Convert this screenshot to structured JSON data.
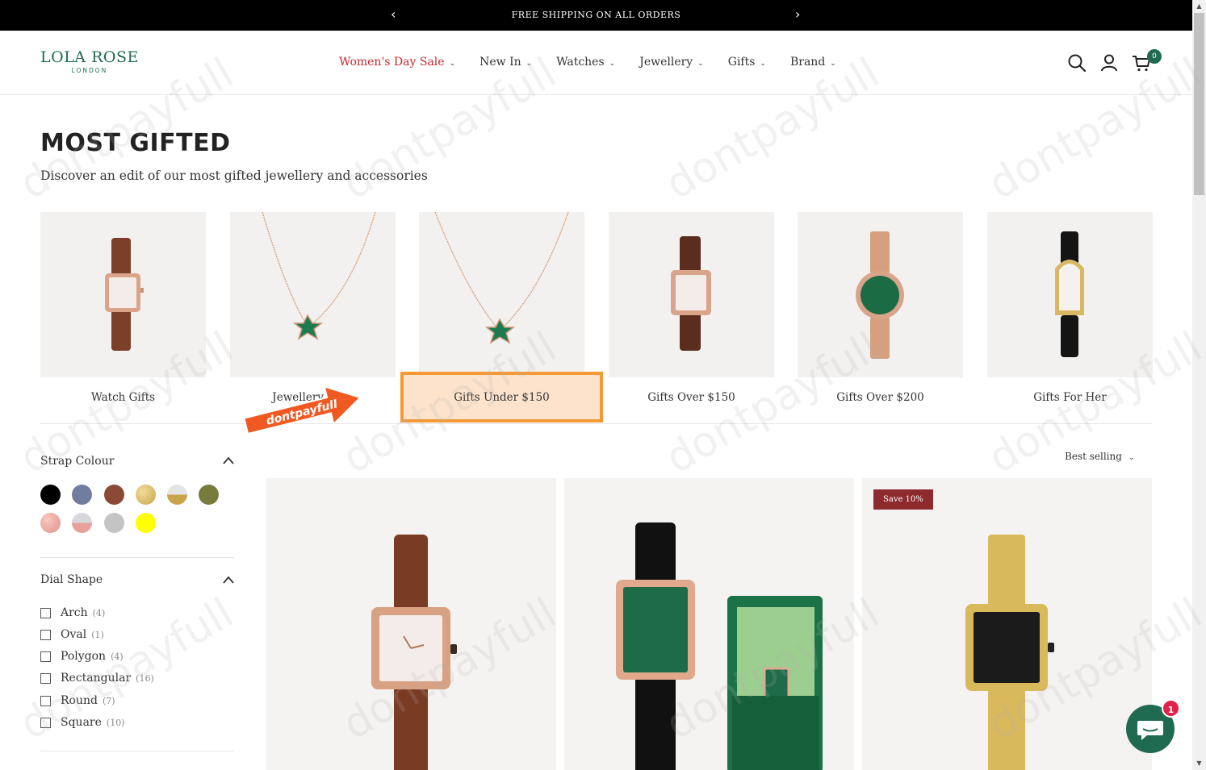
{
  "announcement": {
    "text": "FREE SHIPPING ON ALL ORDERS",
    "prev": "‹",
    "next": "›"
  },
  "logo": {
    "main": "LOLA ROSE",
    "sub": "LONDON"
  },
  "nav": {
    "items": [
      {
        "label": "Women's Day Sale"
      },
      {
        "label": "New In"
      },
      {
        "label": "Watches"
      },
      {
        "label": "Jewellery"
      },
      {
        "label": "Gifts"
      },
      {
        "label": "Brand"
      }
    ],
    "chevron": "⌄"
  },
  "cart": {
    "count": "0"
  },
  "page": {
    "title": "MOST GIFTED",
    "description": "Discover an edit of our most gifted jewellery and accessories"
  },
  "categories": [
    {
      "label": "Watch Gifts"
    },
    {
      "label": "Jewellery Gifts"
    },
    {
      "label": "Gifts Under $150"
    },
    {
      "label": "Gifts Over $150"
    },
    {
      "label": "Gifts Over $200"
    },
    {
      "label": "Gifts For Her"
    }
  ],
  "promo": {
    "text": "dontpayfull"
  },
  "filters": {
    "strap_colour": {
      "title": "Strap Colour",
      "toggle": "^",
      "swatches": [
        "#000000",
        "#6f7d9e",
        "#8a4a35",
        "#d9bc62",
        "#c9c5be",
        "#777b3b",
        "#e8a09a",
        "#d0cfd3",
        "#c4c4c4",
        "#ffff00"
      ]
    },
    "dial_shape": {
      "title": "Dial Shape",
      "toggle": "^",
      "options": [
        {
          "name": "Arch",
          "count": "(4)"
        },
        {
          "name": "Oval",
          "count": "(1)"
        },
        {
          "name": "Polygon",
          "count": "(4)"
        },
        {
          "name": "Rectangular",
          "count": "(16)"
        },
        {
          "name": "Round",
          "count": "(7)"
        },
        {
          "name": "Square",
          "count": "(10)"
        }
      ]
    }
  },
  "sort": {
    "label": "Best selling",
    "chevron": "⌄"
  },
  "products": [
    {
      "badge": ""
    },
    {
      "badge": ""
    },
    {
      "badge": "Save 10%"
    }
  ],
  "chat": {
    "unread": "1"
  },
  "colors": {
    "brand_green": "#1f6b52",
    "sale_red": "#c8262c",
    "highlight_orange": "#f39a35",
    "badge_red": "#8c2a2e"
  }
}
